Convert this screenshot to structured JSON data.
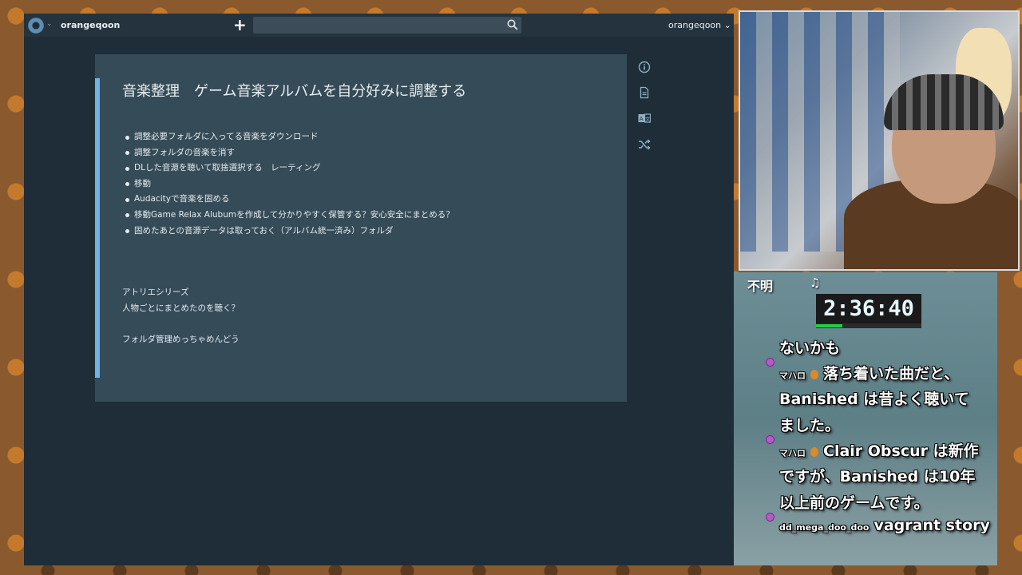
{
  "topbar": {
    "username_left": "orangeqoon",
    "add_label": "+",
    "search_placeholder": "",
    "username_right": "orangeqoon ⌄"
  },
  "note": {
    "title": "音楽整理　ゲーム音楽アルバムを自分好みに調整する",
    "bullets": [
      "調整必要フォルダに入ってる音楽をダウンロード",
      "調整フォルダの音楽を消す",
      "DLした音源を聴いて取捨選択する　レーティング",
      "移動",
      "Audacityで音楽を固める",
      "移動Game Relax Alubumを作成して分かりやすく保管する？安心安全にまとめる？",
      "固めたあとの音源データは取っておく（アルバム統一済み）フォルダ"
    ],
    "lines": [
      "アトリエシリーズ",
      "人物ごとにまとめたのを聴く？",
      "",
      "フォルダ管理めっちゃめんどう"
    ]
  },
  "side_icons": [
    "info-icon",
    "document-icon",
    "translate-icon",
    "shuffle-icon"
  ],
  "overlay": {
    "song_title": "不明",
    "music_symbol": "♫",
    "timer": "2:36:40",
    "timer_progress": 0.25,
    "timer_bar_color": "#1fd040",
    "chat": [
      {
        "user": "",
        "text": "ないかも"
      },
      {
        "user": "マハロ",
        "text": "落ち着いた曲だと、"
      },
      {
        "user": "",
        "text": "Banished は昔よく聴いて"
      },
      {
        "user": "",
        "text": "ました。"
      },
      {
        "user": "マハロ",
        "text": "Clair Obscur は新作"
      },
      {
        "user": "",
        "text": "ですが、Banished は10年"
      },
      {
        "user": "",
        "text": "以上前のゲームです。"
      },
      {
        "user": "dd_mega_doo_doo",
        "text": "vagrant story"
      }
    ]
  },
  "colors": {
    "app_bg": "#1e2d37",
    "card_bg": "#354b58",
    "accent": "#6fb3e4"
  }
}
